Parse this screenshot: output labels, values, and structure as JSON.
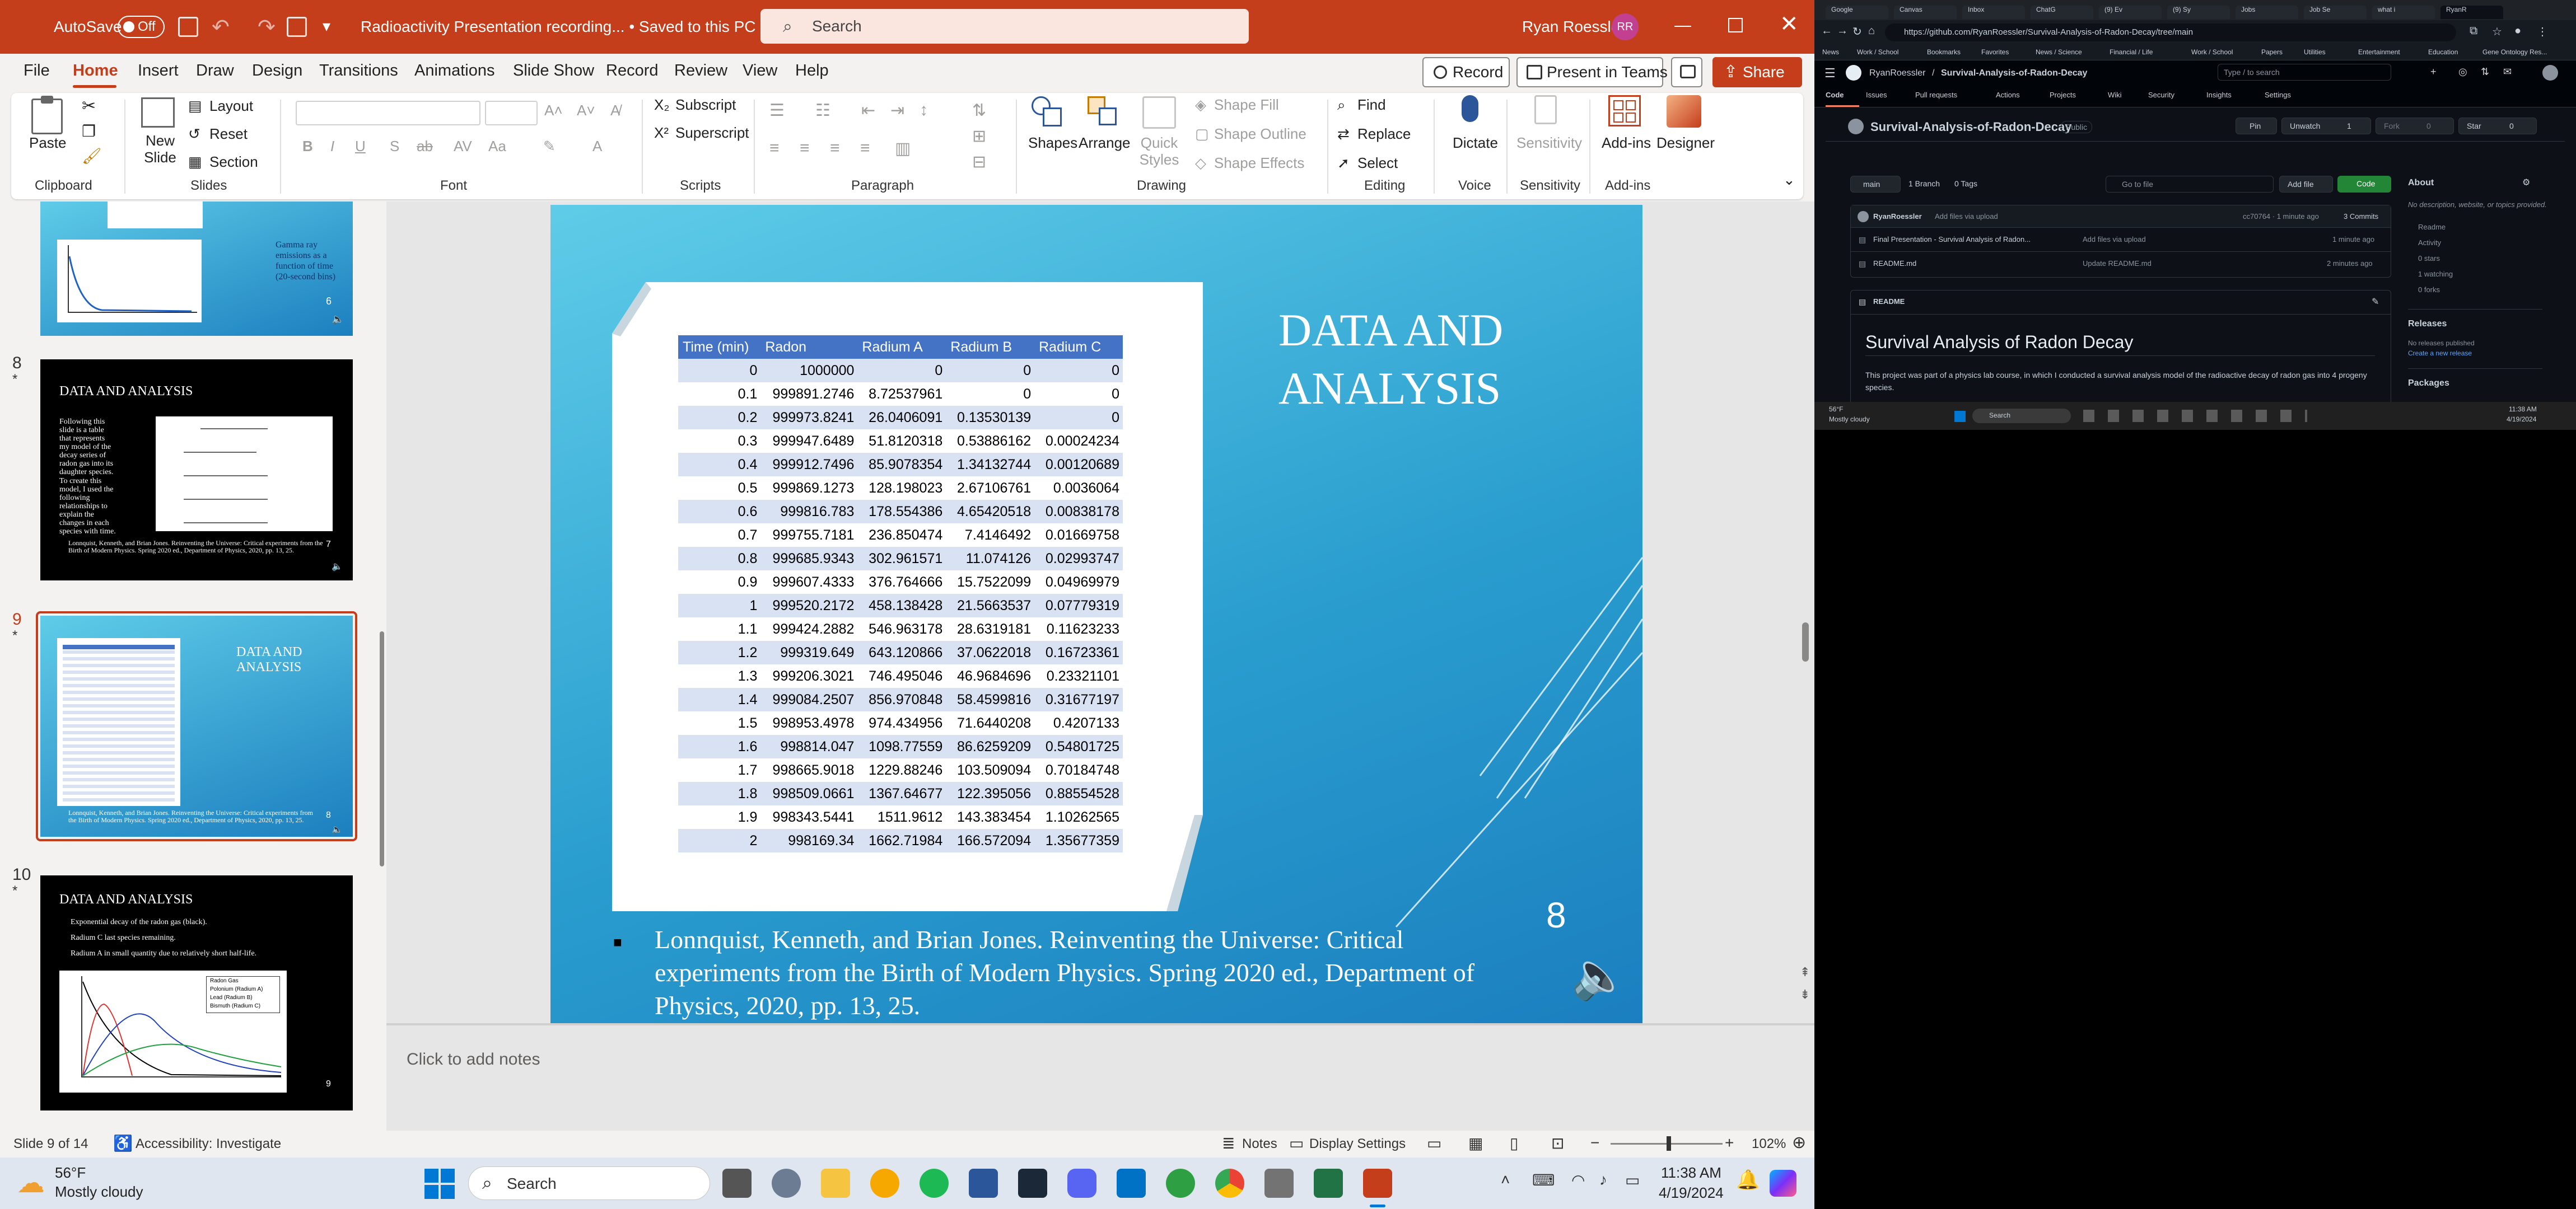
{
  "powerpoint": {
    "autosave_label": "AutoSave",
    "autosave_state": "Off",
    "doc_title": "Radioactivity Presentation recording... • Saved to this PC",
    "search_placeholder": "Search",
    "user_name": "Ryan Roessler",
    "user_initials": "RR",
    "menu_tabs": [
      "File",
      "Home",
      "Insert",
      "Draw",
      "Design",
      "Transitions",
      "Animations",
      "Slide Show",
      "Record",
      "Review",
      "View",
      "Help"
    ],
    "record_button": "Record",
    "present_button": "Present in Teams",
    "share_button": "Share",
    "ribbon": {
      "paste": "Paste",
      "new_slide": "New Slide",
      "layout": "Layout",
      "reset": "Reset",
      "section": "Section",
      "subscript": "Subscript",
      "superscript": "Superscript",
      "shapes": "Shapes",
      "arrange": "Arrange",
      "quick_styles": "Quick Styles",
      "shape_fill": "Shape Fill",
      "shape_outline": "Shape Outline",
      "shape_effects": "Shape Effects",
      "find": "Find",
      "replace": "Replace",
      "select": "Select",
      "dictate": "Dictate",
      "sensitivity": "Sensitivity",
      "addins": "Add-ins",
      "designer": "Designer",
      "groups": [
        "Clipboard",
        "Slides",
        "Font",
        "Scripts",
        "Paragraph",
        "Drawing",
        "Editing",
        "Voice",
        "Sensitivity",
        "Add-ins"
      ]
    },
    "thumbnails": [
      {
        "num": "6",
        "text": "Gamma ray emissions as a function of time (20-second bins)"
      },
      {
        "num": "8",
        "title": "DATA AND ANALYSIS",
        "bullets": [
          "Following this slide is a table that represents my model of the decay series of radon gas into its daughter species.",
          "To create this model, I used the following relationships to explain the changes in each species with time."
        ],
        "cite": "Lonnquist, Kenneth, and Brian Jones. Reinventing the Universe: Critical experiments from the Birth of Modern Physics. Spring 2020 ed., Department of Physics, 2020, pp. 13, 25.",
        "page": "7"
      },
      {
        "num": "9",
        "title": "DATA AND ANALYSIS",
        "cite": "Lonnquist, Kenneth, and Brian Jones. Reinventing the Universe: Critical experiments from the Birth of Modern Physics. Spring 2020 ed., Department of Physics, 2020, pp. 13, 25.",
        "page": "8"
      },
      {
        "num": "10",
        "title": "DATA AND ANALYSIS",
        "bullets": [
          "Exponential decay of the radon gas (black).",
          "Radium C last species remaining.",
          "Radium A in small quantity due to relatively short half-life."
        ],
        "legend": [
          "Radon Gas",
          "Polonium (Radium A)",
          "Lead (Radium B)",
          "Bismuth (Radium C)"
        ],
        "page": "9"
      }
    ],
    "slide": {
      "title": "DATA AND ANALYSIS",
      "number": "8",
      "citation": "Lonnquist, Kenneth, and Brian Jones. Reinventing the Universe: Critical experiments from the Birth of Modern Physics. Spring 2020 ed., Department of Physics, 2020, pp. 13, 25.",
      "table": {
        "headers": [
          "Time (min)",
          "Radon",
          "Radium A",
          "Radium B",
          "Radium C"
        ],
        "rows": [
          [
            "0",
            "1000000",
            "0",
            "0",
            "0"
          ],
          [
            "0.1",
            "999891.2746",
            "8.72537961",
            "0",
            "0"
          ],
          [
            "0.2",
            "999973.8241",
            "26.0406091",
            "0.13530139",
            "0"
          ],
          [
            "0.3",
            "999947.6489",
            "51.8120318",
            "0.53886162",
            "0.00024234"
          ],
          [
            "0.4",
            "999912.7496",
            "85.9078354",
            "1.34132744",
            "0.00120689"
          ],
          [
            "0.5",
            "999869.1273",
            "128.198023",
            "2.67106761",
            "0.0036064"
          ],
          [
            "0.6",
            "999816.783",
            "178.554386",
            "4.65420518",
            "0.00838178"
          ],
          [
            "0.7",
            "999755.7181",
            "236.850474",
            "7.4146492",
            "0.01669758"
          ],
          [
            "0.8",
            "999685.9343",
            "302.961571",
            "11.074126",
            "0.02993747"
          ],
          [
            "0.9",
            "999607.4333",
            "376.764666",
            "15.7522099",
            "0.04969979"
          ],
          [
            "1",
            "999520.2172",
            "458.138428",
            "21.5663537",
            "0.07779319"
          ],
          [
            "1.1",
            "999424.2882",
            "546.963178",
            "28.6319181",
            "0.11623233"
          ],
          [
            "1.2",
            "999319.649",
            "643.120866",
            "37.0622018",
            "0.16723361"
          ],
          [
            "1.3",
            "999206.3021",
            "746.495046",
            "46.9684696",
            "0.23321101"
          ],
          [
            "1.4",
            "999084.2507",
            "856.970848",
            "58.4599816",
            "0.31677197"
          ],
          [
            "1.5",
            "998953.4978",
            "974.434956",
            "71.6440208",
            "0.4207133"
          ],
          [
            "1.6",
            "998814.047",
            "1098.77559",
            "86.6259209",
            "0.54801725"
          ],
          [
            "1.7",
            "998665.9018",
            "1229.88246",
            "103.509094",
            "0.70184748"
          ],
          [
            "1.8",
            "998509.0661",
            "1367.64677",
            "122.395056",
            "0.88554528"
          ],
          [
            "1.9",
            "998343.5441",
            "1511.9612",
            "143.383454",
            "1.10262565"
          ],
          [
            "2",
            "998169.34",
            "1662.71984",
            "166.572094",
            "1.35677359"
          ]
        ]
      }
    },
    "notes_placeholder": "Click to add notes",
    "status": {
      "slide_info": "Slide 9 of 14",
      "accessibility": "Accessibility: Investigate",
      "notes": "Notes",
      "display_settings": "Display Settings",
      "zoom": "102%"
    }
  },
  "taskbar": {
    "weather_temp": "56°F",
    "weather_desc": "Mostly cloudy",
    "search": "Search",
    "time": "11:38 AM",
    "date": "4/19/2024"
  },
  "browser": {
    "url": "https://github.com/RyanRoessler/Survival-Analysis-of-Radon-Decay/tree/main",
    "tabs": [
      "Google",
      "Canvas",
      "Inbox",
      "ChatG",
      "(9) Ev",
      "(9) Sy",
      "Jobs",
      "Job Se",
      "what i",
      "RyanR"
    ],
    "bookmarks": [
      "News",
      "Work / School",
      "Bookmarks",
      "Favorites",
      "News / Science",
      "Financial / Life",
      "Work / School",
      "Papers",
      "Utilities",
      "Entertainment",
      "Education",
      "Gene Ontology Res..."
    ],
    "owner": "RyanRoessler",
    "repo": "Survival-Analysis-of-Radon-Decay",
    "visibility": "Public",
    "repo_tabs": [
      "Code",
      "Issues",
      "Pull requests",
      "Actions",
      "Projects",
      "Wiki",
      "Security",
      "Insights",
      "Settings"
    ],
    "pin": "Pin",
    "unwatch": "Unwatch",
    "unwatch_count": "1",
    "fork": "Fork",
    "fork_count": "0",
    "star": "Star",
    "star_count": "0",
    "search_placeholder": "Type / to search",
    "branch": "main",
    "branch_count": "1 Branch",
    "tags_count": "0 Tags",
    "go_to_file": "Go to file",
    "add_file": "Add file",
    "code_button": "Code",
    "commit_author": "RyanRoessler",
    "commit_msg": "Add files via upload",
    "commit_hash": "cc70764 · 1 minute ago",
    "commits": "3 Commits",
    "files": [
      {
        "name": "Final Presentation - Survival Analysis of Radon...",
        "msg": "Add files via upload",
        "time": "1 minute ago"
      },
      {
        "name": "README.md",
        "msg": "Update README.md",
        "time": "2 minutes ago"
      }
    ],
    "readme_label": "README",
    "readme_title": "Survival Analysis of Radon Decay",
    "readme_text": "This project was part of a physics lab course, in which I conducted a survival analysis model of the radioactive decay of radon gas into 4 progeny species.",
    "about_title": "About",
    "about_text": "No description, website, or topics provided.",
    "about_items": [
      "Readme",
      "Activity",
      "0 stars",
      "1 watching",
      "0 forks"
    ],
    "releases_title": "Releases",
    "releases_text": "No releases published",
    "releases_link": "Create a new release",
    "packages_title": "Packages",
    "mini_taskbar": {
      "temp": "56°F",
      "desc": "Mostly cloudy",
      "search": "Search",
      "time": "11:38 AM",
      "date": "4/19/2024"
    }
  },
  "colors": {
    "ppt_accent": "#c43e1c",
    "table_header": "#4472c4",
    "table_band": "#d9e2f3",
    "github_bg": "#0d1117",
    "github_code_btn": "#238636"
  }
}
